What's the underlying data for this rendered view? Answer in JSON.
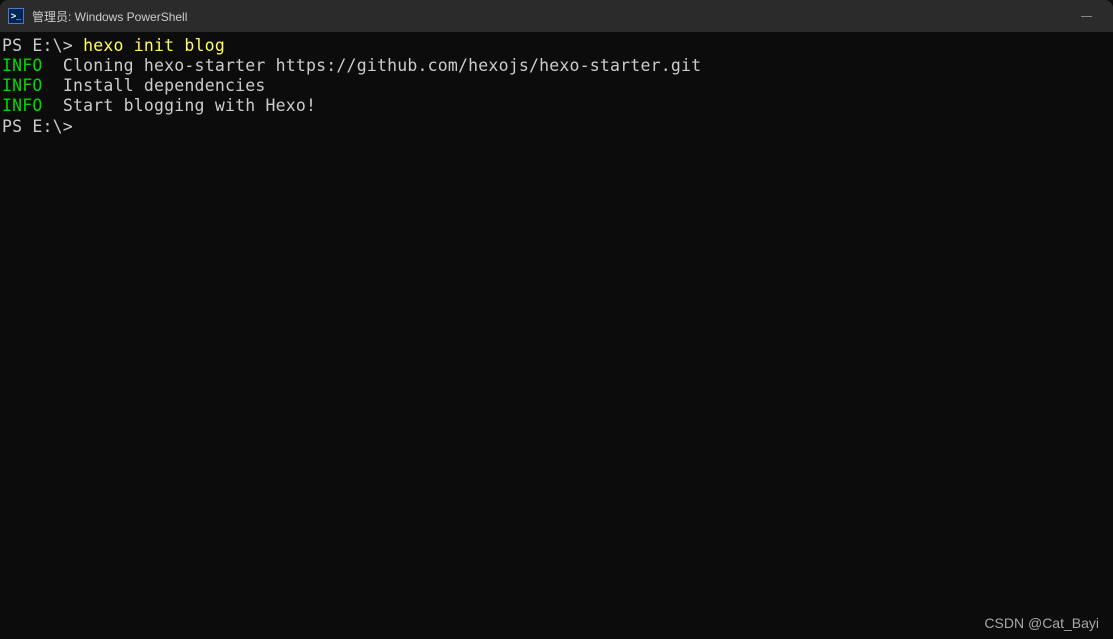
{
  "titlebar": {
    "icon_label": ">_",
    "title": "管理员: Windows PowerShell"
  },
  "terminal": {
    "prompt1": "PS E:\\> ",
    "command1": "hexo init blog",
    "lines": [
      {
        "tag": "INFO",
        "text": "  Cloning hexo-starter https://github.com/hexojs/hexo-starter.git"
      },
      {
        "tag": "INFO",
        "text": "  Install dependencies"
      },
      {
        "tag": "INFO",
        "text": "  Start blogging with Hexo!"
      }
    ],
    "prompt2": "PS E:\\>"
  },
  "watermark": "CSDN @Cat_Bayi"
}
